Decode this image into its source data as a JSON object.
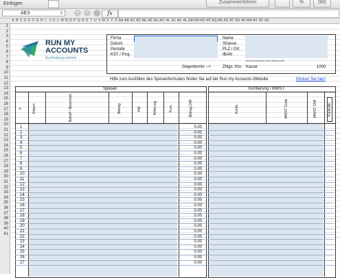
{
  "toolbar": {
    "insert_label": "Einfügen",
    "merge_label": "Zusammenführen",
    "percent_label": "%",
    "format_label": "000"
  },
  "formula_bar": {
    "cell_ref": "AE3",
    "fx_label": "fx",
    "cancel_glyph": "×",
    "accept_glyph": "✓"
  },
  "columns": [
    "A",
    "B",
    "C",
    "D",
    "E",
    "F",
    "G",
    "H",
    "I",
    "J",
    "K",
    "L",
    "M",
    "N",
    "O",
    "P",
    "Q",
    "R",
    "S",
    "T",
    "U",
    "V",
    "W",
    "X",
    "Y",
    "Z",
    "AA",
    "AB",
    "AC",
    "AD",
    "AE",
    "AF",
    "AG",
    "AH",
    "AI",
    "AJ",
    "AK",
    "AL",
    "AM",
    "AN",
    "AO",
    "AP",
    "AQ",
    "AR",
    "AS",
    "AT",
    "AU",
    "AV",
    "AW",
    "AX",
    "AY",
    "AZ"
  ],
  "rows": [
    "1",
    "2",
    "3",
    "4",
    "5",
    "6",
    "7",
    "8",
    "9",
    "10",
    "11",
    "12",
    "13",
    "14",
    "15",
    "16",
    "17",
    "18",
    "19",
    "20",
    "21",
    "22",
    "23",
    "24",
    "25",
    "26",
    "27",
    "28",
    "29",
    "30",
    "31",
    "32",
    "33",
    "34",
    "35",
    "36",
    "37",
    "38",
    "39",
    "40",
    "41"
  ],
  "logo": {
    "line1": "RUN MY",
    "line2": "ACCOUNTS",
    "tagline": "Buchhaltung einfach"
  },
  "header_form": {
    "left_labels": [
      "Firma",
      "Datum",
      "Periode",
      "KST / Proj."
    ],
    "right_labels": [
      "Name",
      "Strasse",
      "PLZ / Ort",
      "IBAN"
    ],
    "iban_note": "Bei Auszahlung aufs Bankkonto",
    "gegenkonto_label": "Gegenkonto -->",
    "zahlg_label": "Zhlgs. Kto.",
    "zahlg_value": "Kasse",
    "zahlg_number": "1000"
  },
  "help_text": "Hilfe zum Ausfüllen des Spesenformulars finden Sie auf der Run my Accounts-Website:",
  "help_link": "Klicken Sie hier!",
  "table": {
    "spesen_title": "Spesen",
    "kontierung_title": "Kontierung / MWST",
    "headers": {
      "nr": "#",
      "datum": "Datum",
      "betreff": "Betreff / Beschreib",
      "betrag": "Betrag",
      "km": "KM",
      "waehrung": "Währung",
      "kurs": "Kurs",
      "betrag_chf": "Betrag CHF",
      "konto": "Konto",
      "mwst_code": "MWST Code",
      "mwst_chf": "MWST CHF",
      "kontrolle": "Kontrolle"
    },
    "row_numbers": [
      "1",
      "2",
      "3",
      "4",
      "5",
      "6",
      "7",
      "8",
      "9",
      "10",
      "11",
      "12",
      "13",
      "14",
      "15",
      "16",
      "17",
      "18",
      "19",
      "20",
      "21",
      "22",
      "23",
      "24",
      "25",
      "26",
      "27"
    ],
    "zero_value": "0.00"
  }
}
